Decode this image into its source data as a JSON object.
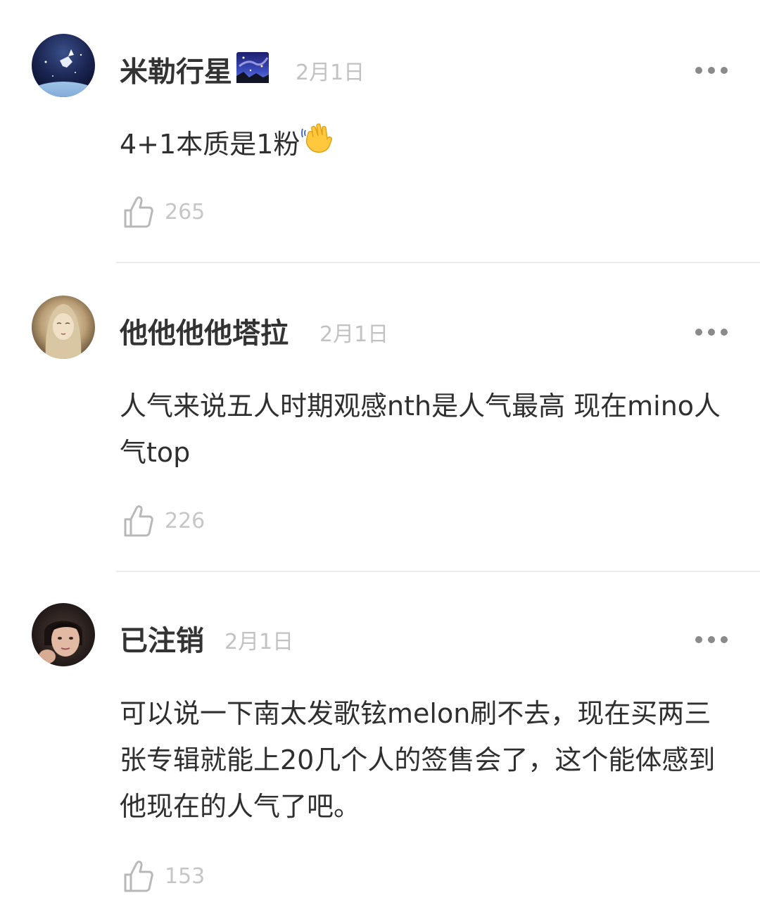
{
  "comments": [
    {
      "username": "米勒行星",
      "date": "2月1日",
      "text": "4+1本质是1粉",
      "likes": "265",
      "emoji_name": "waving-hand-emoji"
    },
    {
      "username": "他他他他塔拉",
      "date": "2月1日",
      "text": "人气来说五人时期观感nth是人气最高 现在mino人气top",
      "likes": "226"
    },
    {
      "username": "已注销",
      "date": "2月1日",
      "text": "可以说一下南太发歌铉melon刷不去，现在买两三张专辑就能上20几个人的签售会了，这个能体感到他现在的人气了吧。",
      "likes": "153"
    }
  ],
  "icons": {
    "like": "thumbs-up-icon",
    "more": "more-dots-icon",
    "username_badge": "night-sky-emoji"
  },
  "colors": {
    "background": "#ffffff",
    "username": "#333333",
    "meta": "#c2c2c2",
    "divider": "#ececec"
  }
}
